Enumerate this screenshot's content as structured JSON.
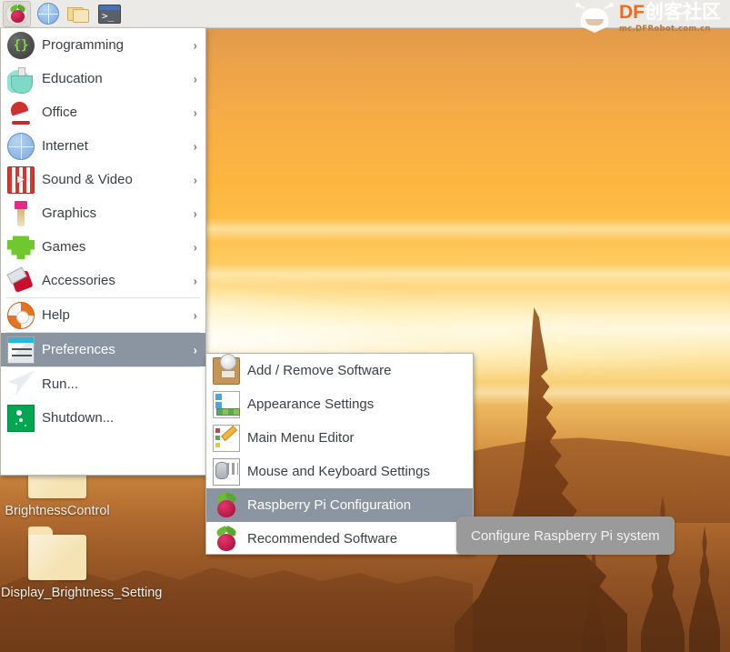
{
  "taskbar": {
    "buttons": [
      {
        "name": "raspberry-menu",
        "icon": "raspberry-pi-icon",
        "label": ""
      },
      {
        "name": "web-browser",
        "icon": "globe-icon",
        "label": ""
      },
      {
        "name": "file-manager",
        "icon": "folder-icon",
        "label": ""
      },
      {
        "name": "terminal",
        "icon": "terminal-icon",
        "label": ""
      }
    ]
  },
  "watermark": {
    "brand_df": "DF",
    "brand_cn": "创客社区",
    "url": "mc.DFRobot.com.cn"
  },
  "main_menu": {
    "items": [
      {
        "label": "Programming",
        "icon": "braces-icon",
        "arrow": "›",
        "selected": false,
        "separator_before": false
      },
      {
        "label": "Education",
        "icon": "flask-icon",
        "arrow": "›",
        "selected": false,
        "separator_before": false
      },
      {
        "label": "Office",
        "icon": "desk-lamp-icon",
        "arrow": "›",
        "selected": false,
        "separator_before": false
      },
      {
        "label": "Internet",
        "icon": "globe-icon",
        "arrow": "›",
        "selected": false,
        "separator_before": false
      },
      {
        "label": "Sound & Video",
        "icon": "popcorn-icon",
        "arrow": "›",
        "selected": false,
        "separator_before": false
      },
      {
        "label": "Graphics",
        "icon": "paintbrush-icon",
        "arrow": "›",
        "selected": false,
        "separator_before": false
      },
      {
        "label": "Games",
        "icon": "space-invader-icon",
        "arrow": "›",
        "selected": false,
        "separator_before": false
      },
      {
        "label": "Accessories",
        "icon": "swiss-knife-icon",
        "arrow": "›",
        "selected": false,
        "separator_before": false
      },
      {
        "label": "Help",
        "icon": "lifebuoy-icon",
        "arrow": "›",
        "selected": false,
        "separator_before": true
      },
      {
        "label": "Preferences",
        "icon": "sliders-icon",
        "arrow": "›",
        "selected": true,
        "separator_before": true
      },
      {
        "label": "Run...",
        "icon": "paper-plane-icon",
        "arrow": "",
        "selected": false,
        "separator_before": true
      },
      {
        "label": "Shutdown...",
        "icon": "exit-runner-icon",
        "arrow": "",
        "selected": false,
        "separator_before": false
      }
    ]
  },
  "sub_menu": {
    "items": [
      {
        "label": "Add / Remove Software",
        "icon": "software-box-icon",
        "selected": false
      },
      {
        "label": "Appearance Settings",
        "icon": "palette-icon",
        "selected": false
      },
      {
        "label": "Main Menu Editor",
        "icon": "menu-edit-icon",
        "selected": false
      },
      {
        "label": "Mouse and Keyboard Settings",
        "icon": "mouse-keyboard-icon",
        "selected": false
      },
      {
        "label": "Raspberry Pi Configuration",
        "icon": "raspberry-pi-icon",
        "selected": true
      },
      {
        "label": "Recommended Software",
        "icon": "raspberry-pi-icon",
        "selected": false
      }
    ]
  },
  "tooltip": {
    "text": "Configure Raspberry Pi system"
  },
  "desktop_icons": [
    {
      "label": "BrightnessControl",
      "icon": "folder-icon"
    },
    {
      "label": "Display_Brightness_Setting",
      "icon": "folder-icon"
    }
  ],
  "colors": {
    "taskbar_bg": "#eceae7",
    "menu_bg": "#ffffff",
    "menu_text": "#3a4046",
    "highlight_bg": "#8a95a1",
    "highlight_text": "#ffffff",
    "tooltip_bg": "#9a9a9a",
    "brand_orange": "#ef6a1e"
  }
}
